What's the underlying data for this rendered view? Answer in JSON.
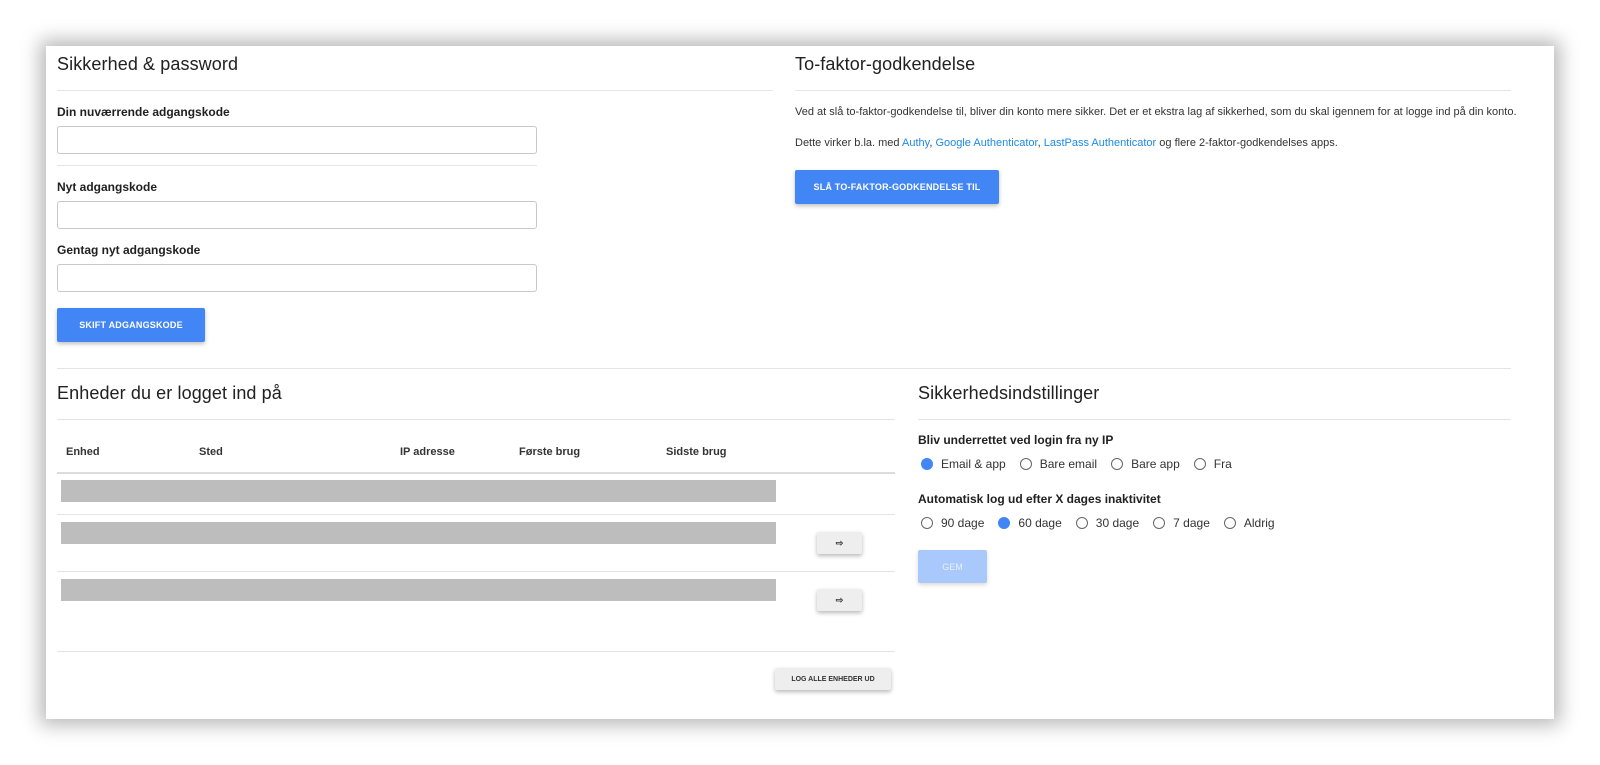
{
  "password_section": {
    "title": "Sikkerhed & password",
    "current_label": "Din nuværrende adgangskode",
    "new_label": "Nyt adgangskode",
    "repeat_label": "Gentag nyt adgangskode",
    "submit_label": "SKIFT ADGANGSKODE"
  },
  "twofactor_section": {
    "title": "To-faktor-godkendelse",
    "description": "Ved at slå to-faktor-godkendelse til, bliver din konto mere sikker. Det er et ekstra lag af sikkerhed, som du skal igennem for at logge ind på din konto.",
    "works_prefix": "Dette virker b.la. med ",
    "apps": [
      "Authy",
      "Google Authenticator",
      "LastPass Authenticator"
    ],
    "sep1": ", ",
    "sep2": ", ",
    "works_suffix": " og flere 2-faktor-godkendelses apps.",
    "enable_label": "SLÅ TO-FAKTOR-GODKENDELSE TIL"
  },
  "devices_section": {
    "title": "Enheder du er logget ind på",
    "columns": [
      "Enhed",
      "Sted",
      "IP adresse",
      "Første brug",
      "Sidste brug"
    ],
    "logout_icon": "⇨",
    "logout_all_label": "LOG ALLE ENHEDER UD"
  },
  "security_settings": {
    "title": "Sikkerhedsindstillinger",
    "notify_label": "Bliv underrettet ved login fra ny IP",
    "notify_options": [
      "Email & app",
      "Bare email",
      "Bare app",
      "Fra"
    ],
    "notify_selected": 0,
    "autologout_label": "Automatisk log ud efter X dages inaktivitet",
    "autologout_options": [
      "90 dage",
      "60 dage",
      "30 dage",
      "7 dage",
      "Aldrig"
    ],
    "autologout_selected": 1,
    "save_label": "GEM"
  },
  "colors": {
    "accent": "#4285f4",
    "link": "#1e88e5",
    "redacted": "#bdbdbd"
  }
}
